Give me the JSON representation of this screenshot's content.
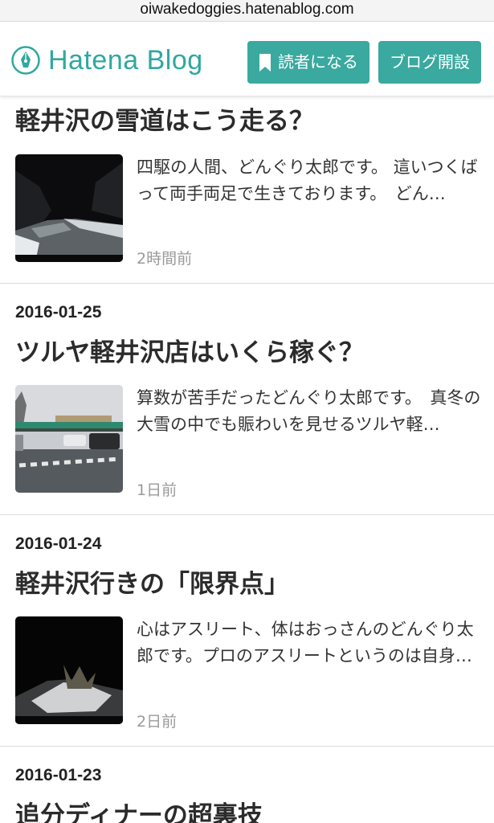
{
  "browser": {
    "url": "oiwakedoggies.hatenablog.com"
  },
  "header": {
    "logo_text": "Hatena Blog",
    "subscribe_label": "読者になる",
    "open_blog_label": "ブログ開設",
    "accent_color": "#3aa99f"
  },
  "entries": [
    {
      "date": "",
      "title": "軽井沢の雪道はこう走る？",
      "summary": "四駆の人間、どんぐり太郎です。 這いつくばって両手両足で生きております。　どん…",
      "ago": "2時間前",
      "thumb": "snowy-night-road"
    },
    {
      "date": "2016-01-25",
      "title": "ツルヤ軽井沢店はいくら稼ぐ？",
      "summary": "算数が苦手だったどんぐり太郎です。　真冬の大雪の中でも賑わいを見せるツルヤ軽…",
      "ago": "1日前",
      "thumb": "store-parking-lot"
    },
    {
      "date": "2016-01-24",
      "title": "軽井沢行きの「限界点」",
      "summary": "心はアスリート、体はおっさんのどんぐり太郎です。プロのアスリートというのは自身…",
      "ago": "2日前",
      "thumb": "dark-forest-road"
    },
    {
      "date": "2016-01-23",
      "title": "追分ディナーの超裏技",
      "summary": "",
      "ago": "",
      "thumb": ""
    }
  ]
}
